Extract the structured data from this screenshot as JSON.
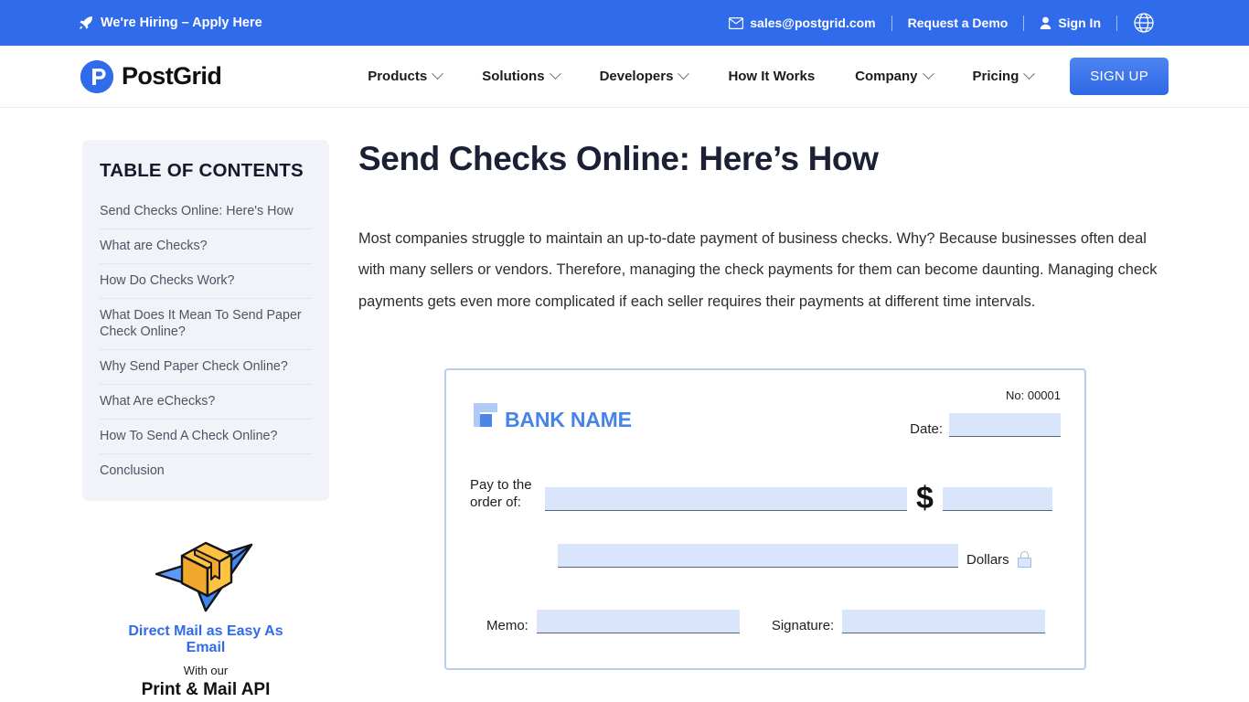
{
  "topbar": {
    "hiring_icon": "rocket-icon",
    "hiring_label": "We're Hiring – Apply Here",
    "email_icon": "envelope-icon",
    "email": "sales@postgrid.com",
    "demo_label": "Request a Demo",
    "signin_icon": "user-icon",
    "signin_label": "Sign In",
    "language_icon": "globe-icon",
    "bg_color": "#2f6bea"
  },
  "nav": {
    "logo_text": "PostGrid",
    "logo_icon": "postgrid-logo-icon",
    "items": [
      {
        "label": "Products",
        "has_dropdown": true
      },
      {
        "label": "Solutions",
        "has_dropdown": true
      },
      {
        "label": "Developers",
        "has_dropdown": true
      },
      {
        "label": "How It Works",
        "has_dropdown": false
      },
      {
        "label": "Company",
        "has_dropdown": true
      },
      {
        "label": "Pricing",
        "has_dropdown": true
      }
    ],
    "signup_label": "SIGN UP",
    "signup_color": "#2f6bea"
  },
  "sidebar": {
    "toc_title": "TABLE OF CONTENTS",
    "toc_items": [
      "Send Checks Online: Here's How",
      "What are Checks?",
      "How Do Checks Work?",
      "What Does It Mean To Send Paper Check Online?",
      "Why Send Paper Check Online?",
      "What Are eChecks?",
      "How To Send A Check Online?",
      "Conclusion"
    ],
    "promo": {
      "art_icon": "package-paper-plane-icon",
      "headline": "Direct Mail as Easy As Email",
      "subline": "With our",
      "product": "Print & Mail API",
      "headline_color": "#2f6bea"
    }
  },
  "article": {
    "title": "Send Checks Online: Here’s How",
    "paragraph": "Most companies struggle to maintain an up-to-date payment of business checks. Why? Because businesses often deal with many sellers or vendors. Therefore, managing the check payments for them can become daunting. Managing check payments gets even more complicated if each seller requires their payments at different time intervals."
  },
  "check_image": {
    "bank_logo_icon": "bank-logo-icon",
    "bank_name": "BANK NAME",
    "check_number": "No: 00001",
    "date_label": "Date:",
    "date_value": "",
    "pay_to_label_line1": "Pay to the",
    "pay_to_label_line2": "order of:",
    "payee_value": "",
    "currency_symbol": "$",
    "amount_value": "",
    "written_amount_value": "",
    "dollars_label": "Dollars",
    "lock_icon": "lock-icon",
    "memo_label": "Memo:",
    "memo_value": "",
    "signature_label": "Signature:",
    "signature_value": "",
    "field_fill_color": "#d9e5fa",
    "border_color": "#b9cdf0"
  }
}
